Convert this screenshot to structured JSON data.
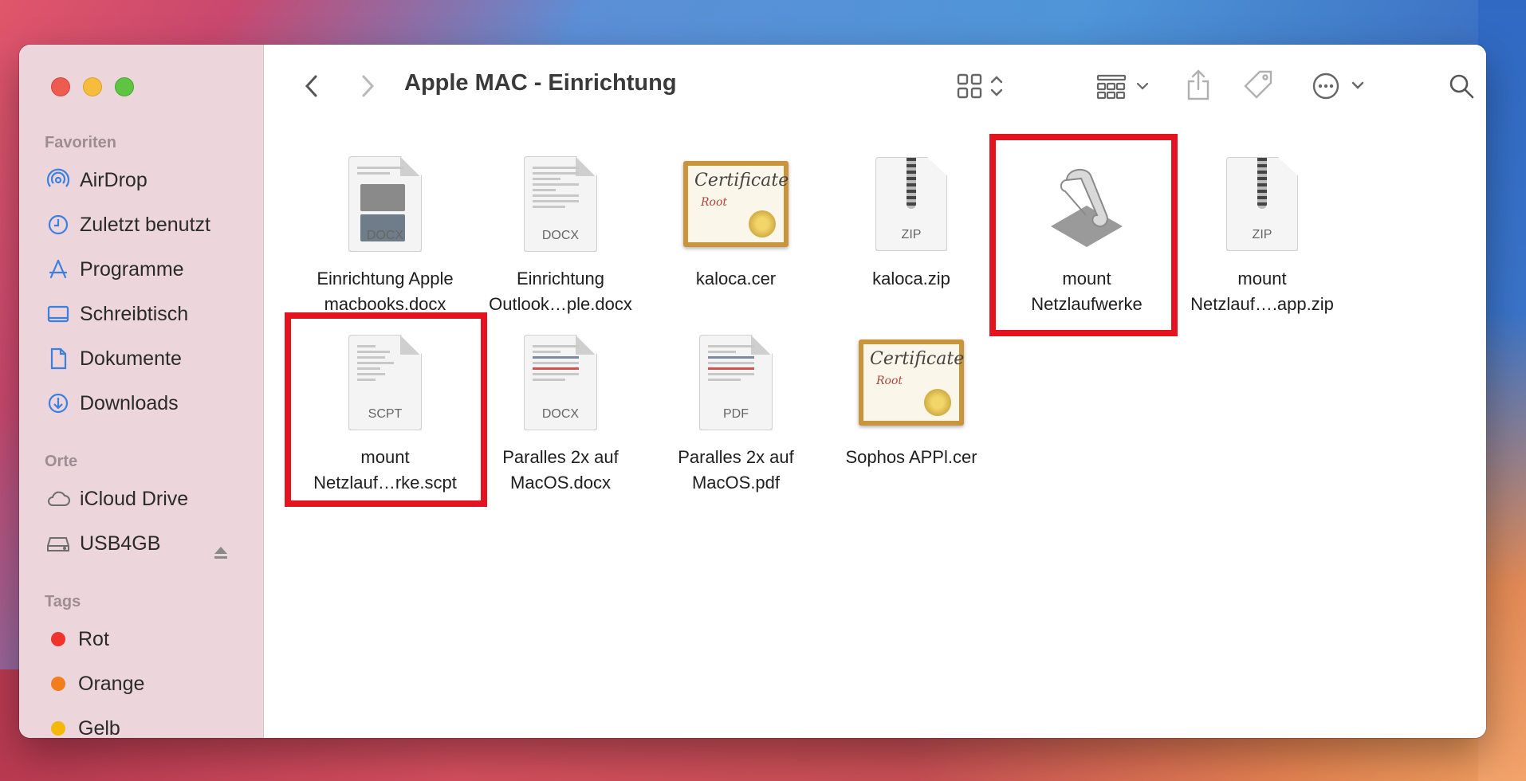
{
  "window": {
    "title": "Apple MAC - Einrichtung"
  },
  "sidebar": {
    "favorites_title": "Favoriten",
    "favorites": [
      {
        "label": "AirDrop",
        "icon": "airdrop-icon"
      },
      {
        "label": "Zuletzt benutzt",
        "icon": "clock-icon"
      },
      {
        "label": "Programme",
        "icon": "applications-icon"
      },
      {
        "label": "Schreibtisch",
        "icon": "desktop-icon"
      },
      {
        "label": "Dokumente",
        "icon": "document-icon"
      },
      {
        "label": "Downloads",
        "icon": "download-icon"
      }
    ],
    "places_title": "Orte",
    "places": [
      {
        "label": "iCloud Drive",
        "icon": "cloud-icon"
      },
      {
        "label": "USB4GB",
        "icon": "drive-icon"
      }
    ],
    "tags_title": "Tags",
    "tags": [
      {
        "label": "Rot",
        "color": "#f0332c"
      },
      {
        "label": "Orange",
        "color": "#f27d1d"
      },
      {
        "label": "Gelb",
        "color": "#f4b806"
      }
    ]
  },
  "files": [
    {
      "name_line1": "Einrichtung Apple",
      "name_line2": "macbooks.docx",
      "type": "docx",
      "ext": "DOCX"
    },
    {
      "name_line1": "Einrichtung",
      "name_line2": "Outlook…ple.docx",
      "type": "docx",
      "ext": "DOCX"
    },
    {
      "name_line1": "kaloca.cer",
      "name_line2": "",
      "type": "cert"
    },
    {
      "name_line1": "kaloca.zip",
      "name_line2": "",
      "type": "zip",
      "ext": "ZIP"
    },
    {
      "name_line1": "mount",
      "name_line2": "Netzlaufwerke",
      "type": "app",
      "highlighted": true
    },
    {
      "name_line1": "mount",
      "name_line2": "Netzlauf….app.zip",
      "type": "zip",
      "ext": "ZIP"
    },
    {
      "name_line1": "mount",
      "name_line2": "Netzlauf…rke.scpt",
      "type": "script",
      "ext": "SCPT",
      "highlighted": true
    },
    {
      "name_line1": "Paralles 2x auf",
      "name_line2": "MacOS.docx",
      "type": "docx",
      "ext": "DOCX"
    },
    {
      "name_line1": "Paralles 2x auf",
      "name_line2": "MacOS.pdf",
      "type": "pdf",
      "ext": "PDF"
    },
    {
      "name_line1": "Sophos APPl.cer",
      "name_line2": "",
      "type": "cert"
    }
  ],
  "cert_art": {
    "line1": "Certificate",
    "line2": "Root"
  },
  "colors": {
    "highlight": "#e3141f",
    "sidebar_bg": "#ecd6dc"
  }
}
